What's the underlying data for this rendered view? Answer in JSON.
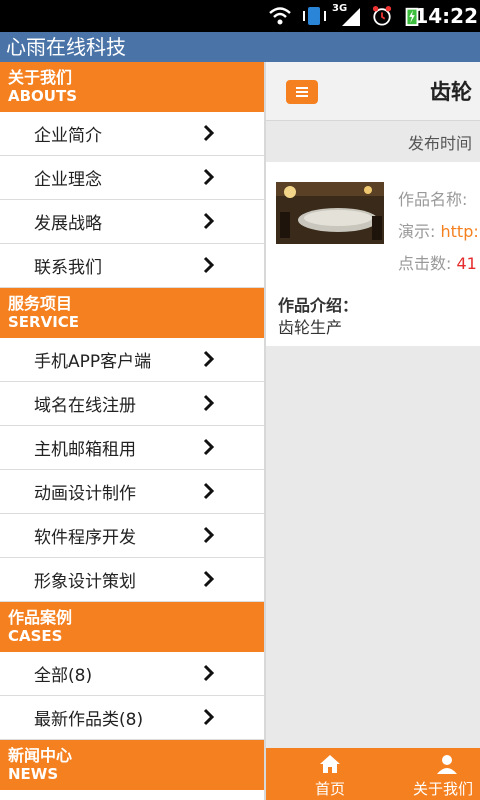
{
  "status_bar": {
    "time": "14:22",
    "network": "3G"
  },
  "app_title": "心雨在线科技",
  "sidebar": {
    "sections": [
      {
        "cn": "关于我们",
        "en": "ABOUTS",
        "items": [
          "企业简介",
          "企业理念",
          "发展战略",
          "联系我们"
        ]
      },
      {
        "cn": "服务项目",
        "en": "SERVICE",
        "items": [
          "手机APP客户端",
          "域名在线注册",
          "主机邮箱租用",
          "动画设计制作",
          "软件程序开发",
          "形象设计策划"
        ]
      },
      {
        "cn": "作品案例",
        "en": "CASES",
        "items": [
          "全部(8)",
          "最新作品类(8)"
        ]
      },
      {
        "cn": "新闻中心",
        "en": "NEWS",
        "items": []
      }
    ]
  },
  "main": {
    "title": "齿轮",
    "publish_label": "发布时间",
    "product": {
      "name_label": "作品名称:",
      "demo_label": "演示:",
      "demo_value": "http:",
      "clicks_label": "点击数:",
      "clicks_value": "41"
    },
    "intro_label": "作品介绍：",
    "intro_text": "齿轮生产"
  },
  "bottom_nav": {
    "home": "首页",
    "about": "关于我们"
  },
  "colors": {
    "accent": "#f5801f",
    "titlebar": "#4a74a8"
  }
}
